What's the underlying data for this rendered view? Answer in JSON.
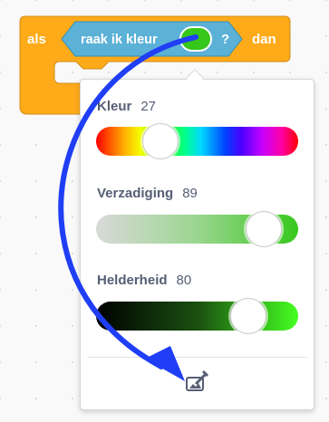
{
  "block": {
    "if_label": "als",
    "sensing_label": "raak ik kleur",
    "question_mark": "?",
    "then_label": "dan",
    "selected_color": "#35c71a",
    "control_color": "#ffab19",
    "sensing_color": "#5cb1d6"
  },
  "color_picker": {
    "hue": {
      "label": "Kleur",
      "value": "27"
    },
    "saturation": {
      "label": "Verzadiging",
      "value": "89"
    },
    "brightness": {
      "label": "Helderheid",
      "value": "80"
    },
    "eyedropper_icon": "eyedropper-icon"
  },
  "annotation": {
    "arrow_color": "#1f3ef5"
  }
}
